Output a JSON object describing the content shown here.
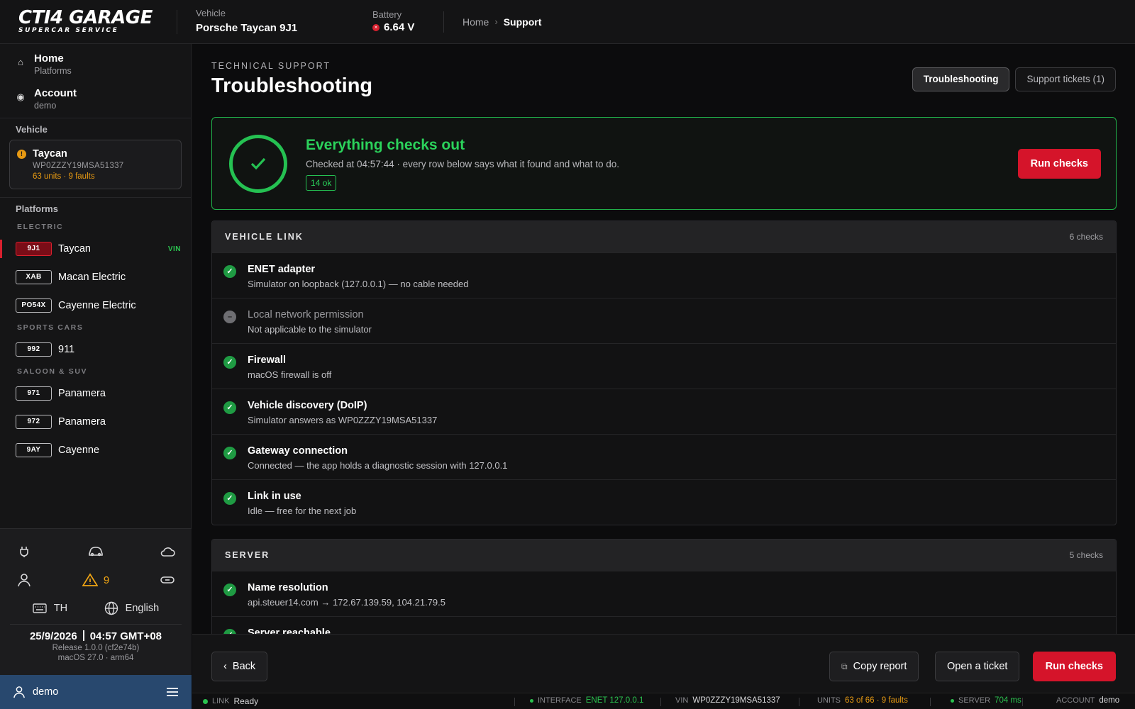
{
  "brand": {
    "name": "CTI4 GARAGE",
    "tagline": "SUPERCAR SERVICE"
  },
  "header": {
    "vehicle_label": "Vehicle",
    "vehicle_value": "Porsche Taycan 9J1",
    "battery_label": "Battery",
    "battery_value": "6.64 V",
    "breadcrumb": {
      "home": "Home",
      "current": "Support"
    }
  },
  "sidebar": {
    "nav": [
      {
        "title": "Home",
        "sub": "Platforms",
        "icon": "home-icon"
      },
      {
        "title": "Account",
        "sub": "demo",
        "icon": "account-icon"
      }
    ],
    "vehicle_section": "Vehicle",
    "vehicle_card": {
      "name": "Taycan",
      "vin": "WP0ZZZY19MSA51337",
      "stats": "63 units · 9 faults"
    },
    "platforms_section": "Platforms",
    "groups": [
      {
        "label": "ELECTRIC",
        "items": [
          {
            "code": "9J1",
            "name": "Taycan",
            "tag": "VIN",
            "active": true
          },
          {
            "code": "XAB",
            "name": "Macan Electric"
          },
          {
            "code": "PO54X",
            "name": "Cayenne Electric"
          }
        ]
      },
      {
        "label": "SPORTS CARS",
        "items": [
          {
            "code": "992",
            "name": "911"
          }
        ]
      },
      {
        "label": "SALOON & SUV",
        "items": [
          {
            "code": "971",
            "name": "Panamera"
          },
          {
            "code": "972",
            "name": "Panamera"
          },
          {
            "code": "9AY",
            "name": "Cayenne"
          }
        ]
      }
    ],
    "tools": {
      "warning_count": "9",
      "keyboard": "TH",
      "language": "English"
    },
    "clock": {
      "date": "25/9/2026",
      "time": "04:57 GMT+08"
    },
    "release": "Release 1.0.0 (cf2e74b)",
    "os": "macOS 27.0 · arm64",
    "user": "demo"
  },
  "main": {
    "eyebrow": "TECHNICAL SUPPORT",
    "title": "Troubleshooting",
    "tabs": [
      {
        "label": "Troubleshooting",
        "active": true
      },
      {
        "label": "Support tickets (1)"
      }
    ],
    "status": {
      "title": "Everything checks out",
      "desc": "Checked at 04:57:44 · every row below says what it found and what to do.",
      "badge": "14 ok",
      "button": "Run checks"
    },
    "groups": [
      {
        "title": "VEHICLE LINK",
        "count": "6 checks",
        "checks": [
          {
            "title": "ENET adapter",
            "desc": "Simulator on loopback (127.0.0.1) — no cable needed",
            "state": "ok"
          },
          {
            "title": "Local network permission",
            "desc": "Not applicable to the simulator",
            "state": "na"
          },
          {
            "title": "Firewall",
            "desc": "macOS firewall is off",
            "state": "ok"
          },
          {
            "title": "Vehicle discovery (DoIP)",
            "desc": "Simulator answers as WP0ZZZY19MSA51337",
            "state": "ok"
          },
          {
            "title": "Gateway connection",
            "desc": "Connected — the app holds a diagnostic session with 127.0.0.1",
            "state": "ok"
          },
          {
            "title": "Link in use",
            "desc": "Idle — free for the next job",
            "state": "ok"
          }
        ]
      },
      {
        "title": "SERVER",
        "count": "5 checks",
        "checks": [
          {
            "title": "Name resolution",
            "desc": "api.steuer14.com → 172.67.139.59, 104.21.79.5",
            "state": "ok"
          },
          {
            "title": "Server reachable",
            "desc": "",
            "state": "ok"
          }
        ]
      }
    ]
  },
  "actions": {
    "back": "Back",
    "copy": "Copy report",
    "ticket": "Open a ticket",
    "run": "Run checks"
  },
  "statusbar": {
    "link_label": "LINK",
    "link_value": "Ready",
    "interface_label": "INTERFACE",
    "interface_value": "ENET 127.0.0.1",
    "vin_label": "VIN",
    "vin_value": "WP0ZZZY19MSA51337",
    "units_label": "UNITS",
    "units_value": "63 of 66 · 9 faults",
    "server_label": "SERVER",
    "server_value": "704 ms",
    "account_label": "ACCOUNT",
    "account_value": "demo"
  }
}
